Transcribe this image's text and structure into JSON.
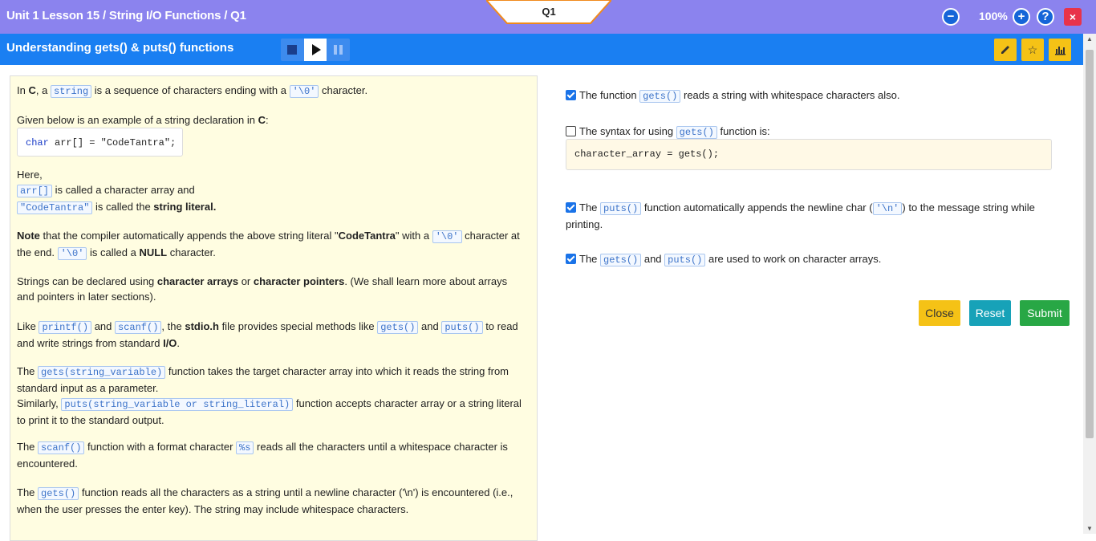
{
  "header": {
    "breadcrumb": "Unit 1 Lesson 15 / String I/O Functions / Q1",
    "question_tab": "Q1",
    "zoom": "100%"
  },
  "subheader": {
    "title": "Understanding gets() & puts() functions"
  },
  "content": {
    "p1": {
      "a": "In ",
      "b": "C",
      "c": ", a ",
      "d": "string",
      "e": " is a sequence of characters ending with a ",
      "f": "'\\0'",
      "g": " character."
    },
    "p2": {
      "a": "Given below is an example of a string declaration in ",
      "b": "C",
      "c": ":"
    },
    "codebox": {
      "kw": "char",
      "rest": " arr[] = \"CodeTantra\";"
    },
    "p3": {
      "here": "Here,",
      "arr": "arr[]",
      "arr_txt": " is called a character array and",
      "lit": "\"CodeTantra\"",
      "lit_txt": " is called the ",
      "lit_bold": "string literal."
    },
    "p4": {
      "a": "Note",
      "b": " that the compiler automatically appends the above string literal \"",
      "c": "CodeTantra",
      "d": "\" with a ",
      "e": "'\\0'",
      "f": " character at the end. ",
      "g": "'\\0'",
      "h": " is called a ",
      "i": "NULL",
      "j": " character."
    },
    "p5": {
      "a": "Strings can be declared using ",
      "b": "character arrays",
      "c": " or ",
      "d": "character pointers",
      "e": ". (We shall learn more about arrays and pointers in later sections)."
    },
    "p6": {
      "a": "Like ",
      "b": "printf()",
      "c": " and ",
      "d": "scanf()",
      "e": ", the ",
      "f": "stdio.h",
      "g": " file provides special methods like ",
      "h": "gets()",
      "i": " and ",
      "j": "puts()",
      "k": " to read and write strings from standard ",
      "l": "I/O",
      "m": "."
    },
    "p7": {
      "a": "The ",
      "b": "gets(string_variable)",
      "c": " function takes the target character array into which it reads the string from standard input as a parameter.",
      "d": "Similarly, ",
      "e": "puts(string_variable or string_literal)",
      "f": " function accepts character array or a string literal to print it to the standard output."
    },
    "p8": {
      "a": "The ",
      "b": "scanf()",
      "c": " function with a format character ",
      "d": "%s",
      "e": " reads all the characters until a whitespace character is encountered."
    },
    "p9": {
      "a": "The ",
      "b": "gets()",
      "c": " function reads all the characters as a string until a newline character ('\\n') is encountered (i.e., when the user presses the enter key). The string may include whitespace characters."
    }
  },
  "options": [
    {
      "checked": true,
      "a": "The function ",
      "b": "gets()",
      "c": " reads a string with whitespace characters also."
    },
    {
      "checked": false,
      "a": "The syntax for using ",
      "b": "gets()",
      "c": " function is:",
      "code": "character_array = gets();"
    },
    {
      "checked": true,
      "a": "The ",
      "b": "puts()",
      "c": " function automatically appends the newline char (",
      "d": "'\\n'",
      "e": ") to the message string while printing."
    },
    {
      "checked": true,
      "a": "The ",
      "b": "gets()",
      "c": " and ",
      "d": "puts()",
      "e": " are used to work on character arrays."
    }
  ],
  "buttons": {
    "close": "Close",
    "reset": "Reset",
    "submit": "Submit"
  },
  "colors": {
    "header": "#8b83ee",
    "subheader": "#1a7ff2",
    "close": "#f5c216",
    "reset": "#17a2b8",
    "submit": "#28a745"
  }
}
